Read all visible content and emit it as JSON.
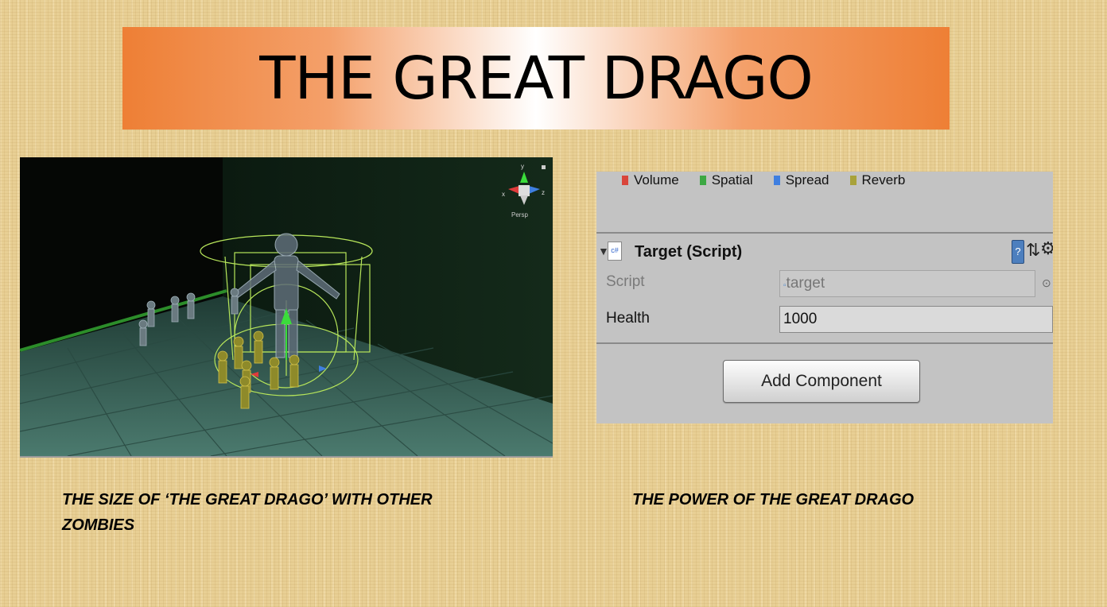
{
  "title": "THE GREAT DRAGO",
  "scene": {
    "gizmo_axes": {
      "y": "y",
      "x": "x",
      "z": "z"
    },
    "projection_label": "Persp"
  },
  "inspector": {
    "legend": [
      {
        "label": "Volume",
        "color": "#d9453a"
      },
      {
        "label": "Spatial",
        "color": "#3ca843"
      },
      {
        "label": "Spread",
        "color": "#3f7fe0"
      },
      {
        "label": "Reverb",
        "color": "#a8a23a"
      }
    ],
    "component": {
      "title": "Target (Script)",
      "fields": {
        "script_label": "Script",
        "script_value": "target",
        "health_label": "Health",
        "health_value": "1000"
      }
    },
    "add_component_label": "Add Component"
  },
  "captions": {
    "left": "THE SIZE OF ‘THE GREAT DRAGO’ WITH OTHER ZOMBIES",
    "right": "THE POWER OF THE GREAT DRAGO"
  }
}
